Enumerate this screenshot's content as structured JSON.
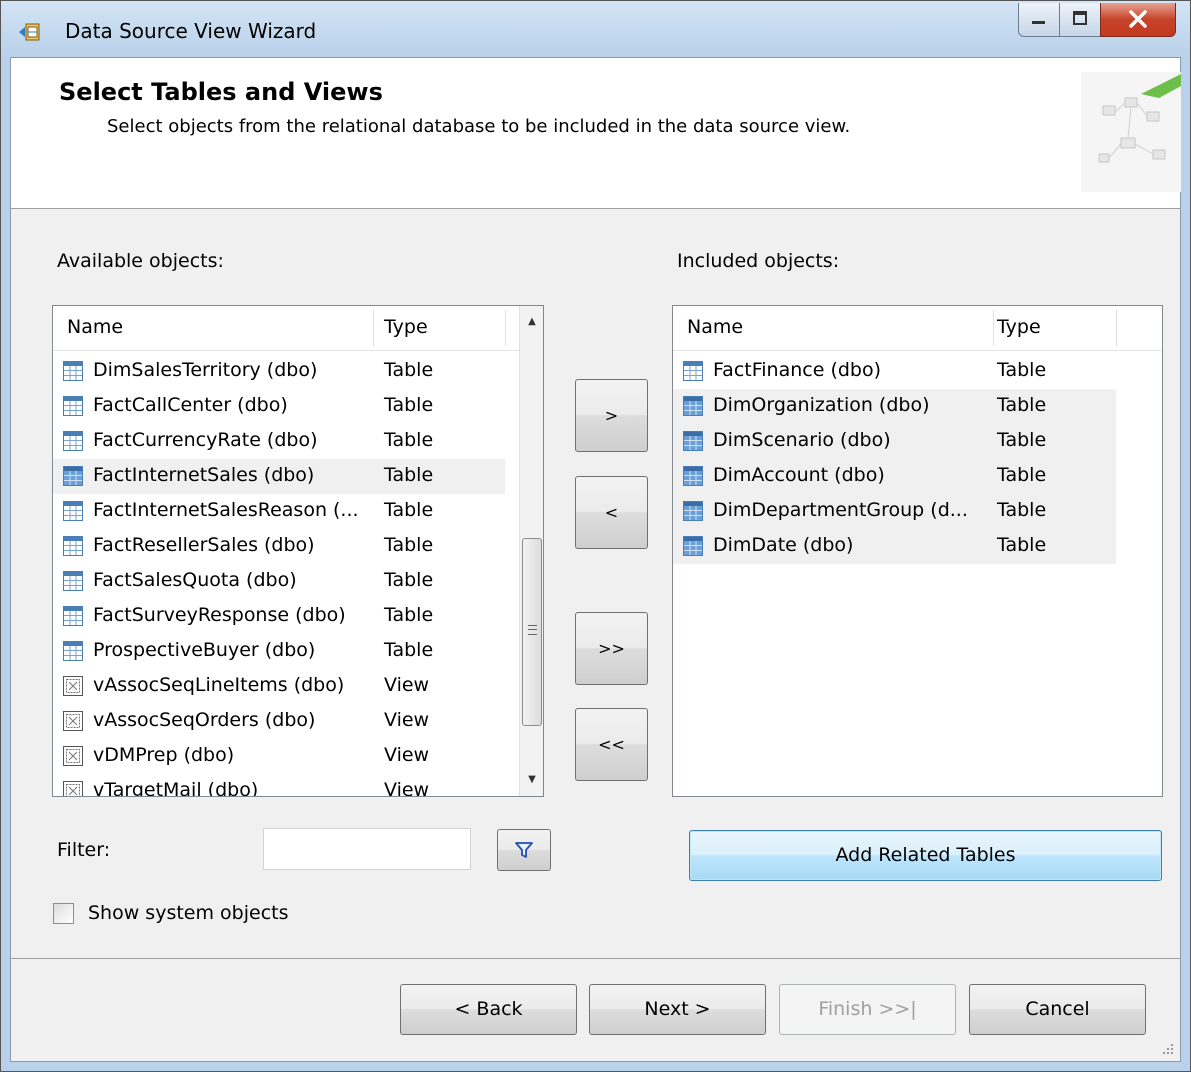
{
  "window": {
    "title": "Data Source View Wizard"
  },
  "header": {
    "title": "Select Tables and Views",
    "subtitle": "Select objects from the relational database to be included in the data source view."
  },
  "available": {
    "label": "Available objects:",
    "col_name": "Name",
    "col_type": "Type",
    "rows": [
      {
        "name": "DimSalesTerritory (dbo)",
        "type": "Table",
        "icon": "table-icon"
      },
      {
        "name": "FactCallCenter (dbo)",
        "type": "Table",
        "icon": "table-icon"
      },
      {
        "name": "FactCurrencyRate (dbo)",
        "type": "Table",
        "icon": "table-icon"
      },
      {
        "name": "FactInternetSales (dbo)",
        "type": "Table",
        "icon": "table-icon"
      },
      {
        "name": "FactInternetSalesReason (...",
        "type": "Table",
        "icon": "table-icon"
      },
      {
        "name": "FactResellerSales (dbo)",
        "type": "Table",
        "icon": "table-icon"
      },
      {
        "name": "FactSalesQuota (dbo)",
        "type": "Table",
        "icon": "table-icon"
      },
      {
        "name": "FactSurveyResponse (dbo)",
        "type": "Table",
        "icon": "table-icon"
      },
      {
        "name": "ProspectiveBuyer (dbo)",
        "type": "Table",
        "icon": "table-icon"
      },
      {
        "name": "vAssocSeqLineItems (dbo)",
        "type": "View",
        "icon": "view-icon"
      },
      {
        "name": "vAssocSeqOrders (dbo)",
        "type": "View",
        "icon": "view-icon"
      },
      {
        "name": "vDMPrep (dbo)",
        "type": "View",
        "icon": "view-icon"
      },
      {
        "name": "vTargetMail (dbo)",
        "type": "View",
        "icon": "view-icon"
      }
    ]
  },
  "included": {
    "label": "Included objects:",
    "col_name": "Name",
    "col_type": "Type",
    "rows": [
      {
        "name": "FactFinance (dbo)",
        "type": "Table",
        "icon": "table-icon"
      },
      {
        "name": "DimOrganization (dbo)",
        "type": "Table",
        "icon": "table-icon"
      },
      {
        "name": "DimScenario (dbo)",
        "type": "Table",
        "icon": "table-icon"
      },
      {
        "name": "DimAccount (dbo)",
        "type": "Table",
        "icon": "table-icon"
      },
      {
        "name": "DimDepartmentGroup (d...",
        "type": "Table",
        "icon": "table-icon"
      },
      {
        "name": "DimDate (dbo)",
        "type": "Table",
        "icon": "table-icon"
      }
    ]
  },
  "move_buttons": {
    "add": ">",
    "remove": "<",
    "add_all": ">>",
    "remove_all": "<<"
  },
  "filter": {
    "label": "Filter:",
    "value": ""
  },
  "add_related_label": "Add Related Tables",
  "show_system_objects": {
    "label": "Show system objects",
    "checked": false
  },
  "footer": {
    "back": "< Back",
    "next": "Next >",
    "finish": "Finish >>|",
    "cancel": "Cancel"
  }
}
